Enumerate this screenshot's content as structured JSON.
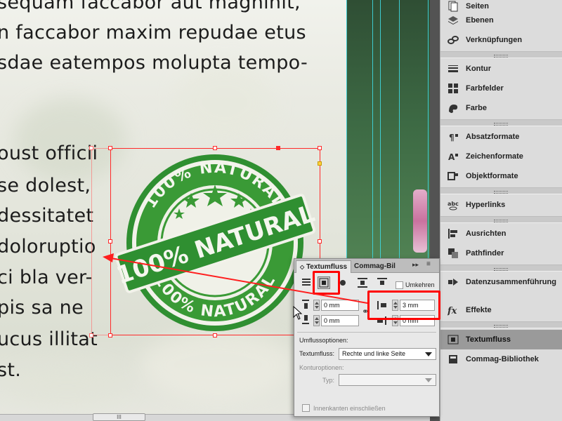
{
  "document": {
    "lines_top": [
      "sequam faccabor aut magnihit,",
      "n faccabor maxim repudae etus",
      "sdae eatempos molupta tempo-"
    ],
    "lines_left": [
      "oust officii",
      "se dolest,",
      "dessitatet",
      "doloruptio",
      "ci bla ver-",
      "pis sa ne",
      "ucus illitat",
      "st."
    ]
  },
  "stamp": {
    "text_top": "100% NATURAL",
    "text_banner": "100% NATURAL",
    "text_bottom": "100% NATURAL",
    "color": "#2e8b2e"
  },
  "colors": {
    "selection": "#ff2a2a",
    "guide": "#3fd8e0",
    "highlight": "#ff0000",
    "panel_active": "#9a9a9a"
  },
  "dock": {
    "items": [
      {
        "label": "Seiten",
        "icon": "pages-icon"
      },
      {
        "label": "Ebenen",
        "icon": "layers-icon"
      },
      {
        "label": "Verknüpfungen",
        "icon": "links-icon"
      },
      {
        "label": "Kontur",
        "icon": "stroke-icon"
      },
      {
        "label": "Farbfelder",
        "icon": "swatches-icon"
      },
      {
        "label": "Farbe",
        "icon": "color-icon"
      },
      {
        "label": "Absatzformate",
        "icon": "paragraph-styles-icon"
      },
      {
        "label": "Zeichenformate",
        "icon": "character-styles-icon"
      },
      {
        "label": "Objektformate",
        "icon": "object-styles-icon"
      },
      {
        "label": "Hyperlinks",
        "icon": "hyperlinks-icon"
      },
      {
        "label": "Ausrichten",
        "icon": "align-icon"
      },
      {
        "label": "Pathfinder",
        "icon": "pathfinder-icon"
      },
      {
        "label": "Datenzusammenführung",
        "icon": "data-merge-icon"
      },
      {
        "label": "Effekte",
        "icon": "effects-icon"
      },
      {
        "label": "Textumfluss",
        "icon": "text-wrap-icon",
        "active": true
      },
      {
        "label": "Commag-Bibliothek",
        "icon": "library-icon"
      }
    ]
  },
  "wrap_panel": {
    "tab_active": "Textumfluss",
    "tab_other": "Commag-Bil",
    "invert_label": "Umkehren",
    "offset_top": "0 mm",
    "offset_bottom": "0 mm",
    "offset_left": "3 mm",
    "offset_right": "0 mm",
    "wrap_options_label": "Umflussoptionen:",
    "wrap_to_label": "Textumfluss:",
    "wrap_to_value": "Rechte und linke Seite",
    "contour_options_label": "Konturoptionen:",
    "type_label": "Typ:",
    "inside_edges_label": "Innenkanten einschließen"
  },
  "scrollbar": {
    "thumb": "III"
  }
}
